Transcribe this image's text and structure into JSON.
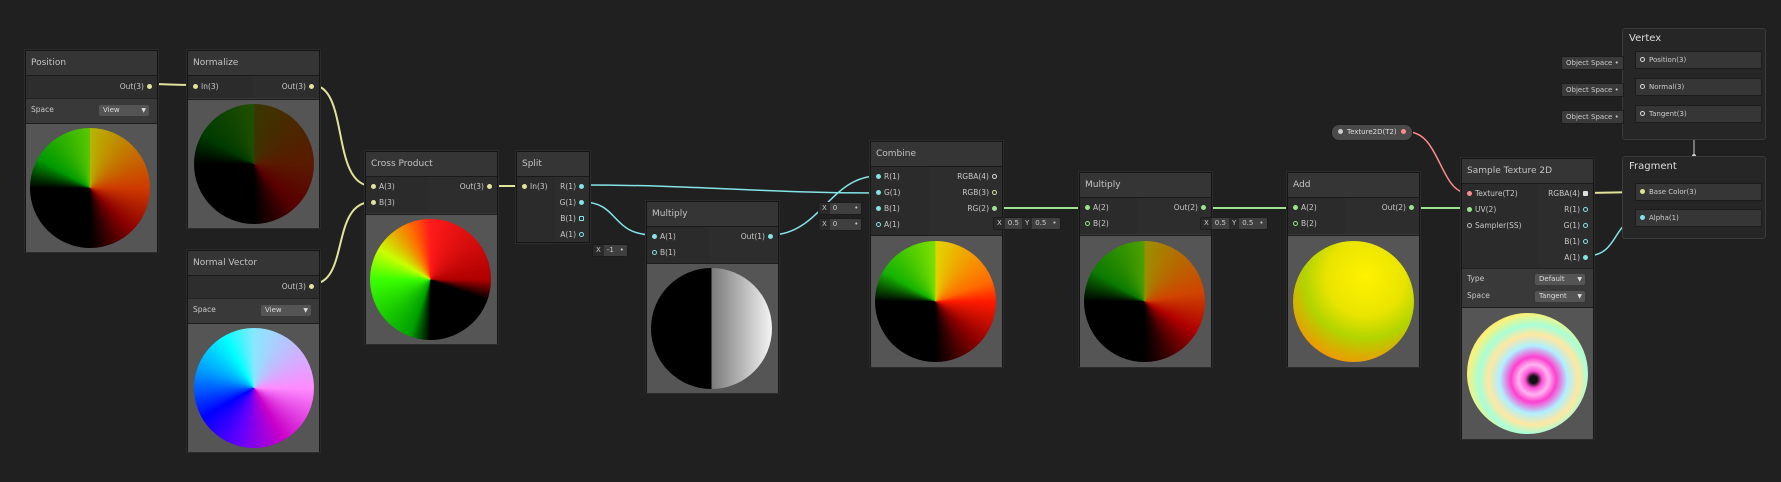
{
  "nodes": {
    "position": {
      "title": "Position",
      "out": "Out(3)",
      "space_label": "Space",
      "space_value": "View"
    },
    "normalize": {
      "title": "Normalize",
      "in": "In(3)",
      "out": "Out(3)"
    },
    "normal_vector": {
      "title": "Normal Vector",
      "out": "Out(3)",
      "space_label": "Space",
      "space_value": "View"
    },
    "cross": {
      "title": "Cross Product",
      "a": "A(3)",
      "b": "B(3)",
      "out": "Out(3)"
    },
    "split": {
      "title": "Split",
      "in": "In(3)",
      "r": "R(1)",
      "g": "G(1)",
      "b": "B(1)",
      "a": "A(1)"
    },
    "multiply1": {
      "title": "Multiply",
      "a": "A(1)",
      "b": "B(1)",
      "out": "Out(1)",
      "b_x": "X",
      "b_val": "-1"
    },
    "combine": {
      "title": "Combine",
      "r": "R(1)",
      "g": "G(1)",
      "b": "B(1)",
      "a": "A(1)",
      "rgba": "RGBA(4)",
      "rgb": "RGB(3)",
      "rg": "RG(2)",
      "b_x": "X",
      "b_val": "0",
      "a_x": "X",
      "a_val": "0"
    },
    "multiply2": {
      "title": "Multiply",
      "a": "A(2)",
      "b": "B(2)",
      "out": "Out(2)",
      "bx": "X",
      "bxv": "0.5",
      "by": "Y",
      "byv": "0.5"
    },
    "add": {
      "title": "Add",
      "a": "A(2)",
      "b": "B(2)",
      "out": "Out(2)",
      "bx": "X",
      "bxv": "0.5",
      "by": "Y",
      "byv": "0.5"
    },
    "texture_prop": {
      "label": "Texture2D(T2)"
    },
    "sample": {
      "title": "Sample Texture 2D",
      "tex": "Texture(T2)",
      "uv": "UV(2)",
      "sampler": "Sampler(SS)",
      "rgba": "RGBA(4)",
      "r": "R(1)",
      "g": "G(1)",
      "b": "B(1)",
      "a": "A(1)",
      "type_label": "Type",
      "type_value": "Default",
      "space_label": "Space",
      "space_value": "Tangent"
    }
  },
  "master": {
    "vertex": {
      "title": "Vertex",
      "slots": [
        {
          "label": "Position(3)",
          "tag": "Object Space"
        },
        {
          "label": "Normal(3)",
          "tag": "Object Space"
        },
        {
          "label": "Tangent(3)",
          "tag": "Object Space"
        }
      ]
    },
    "fragment": {
      "title": "Fragment",
      "slots": [
        {
          "label": "Base Color(3)"
        },
        {
          "label": "Alpha(1)"
        }
      ]
    }
  },
  "colors": {
    "vec3": "#e2e39a",
    "vec2": "#9ce38f",
    "vec1": "#84e4e7",
    "texture": "#ff8b8b",
    "background": "#202020"
  }
}
